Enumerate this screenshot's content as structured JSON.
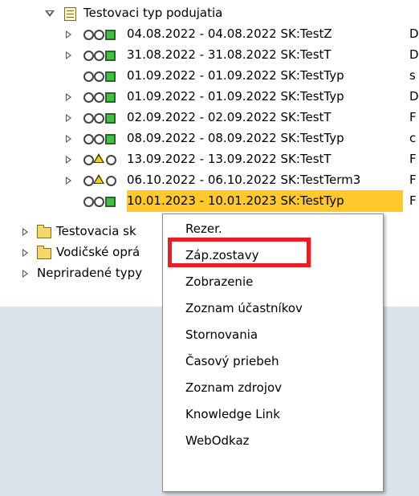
{
  "tree": {
    "root_label": "Testovaci typ podujatia",
    "events": [
      {
        "label": "04.08.2022 - 04.08.2022 SK:TestZ",
        "col2": "D",
        "status": "green",
        "expandable": true
      },
      {
        "label": "31.08.2022 - 31.08.2022 SK:TestT",
        "col2": "D",
        "status": "green",
        "expandable": true
      },
      {
        "label": "01.09.2022 - 01.09.2022 SK:TestTyp",
        "col2": "s",
        "status": "green",
        "expandable": false
      },
      {
        "label": "01.09.2022 - 01.09.2022 SK:TestTyp",
        "col2": "D",
        "status": "green",
        "expandable": true
      },
      {
        "label": "02.09.2022 - 02.09.2022 SK:TestT",
        "col2": "F",
        "status": "green",
        "expandable": true
      },
      {
        "label": "08.09.2022 - 08.09.2022 SK:TestTyp",
        "col2": "c",
        "status": "green",
        "expandable": true
      },
      {
        "label": "13.09.2022 - 13.09.2022 SK:TestT",
        "col2": "F",
        "status": "yellow",
        "expandable": true
      },
      {
        "label": "06.10.2022 - 06.10.2022 SK:TestTerm3",
        "col2": "F",
        "status": "yellow",
        "expandable": true
      },
      {
        "label": "10.01.2023 - 10.01.2023 SK:TestTyp",
        "col2": "F",
        "status": "green",
        "expandable": false,
        "selected": true
      }
    ],
    "folders": [
      {
        "label": "Testovacia sk"
      },
      {
        "label": "Vodičské oprá"
      }
    ],
    "unassigned": "Nepriradené typy"
  },
  "context_menu": {
    "items": [
      "Rezer.",
      "Záp.zostavy",
      "Zobrazenie",
      "Zoznam účastníkov",
      "Stornovania",
      "Časový priebeh",
      "Zoznam zdrojov",
      "Knowledge Link",
      "WebOdkaz"
    ],
    "highlighted": "Záp.zostavy"
  },
  "colors": {
    "selection": "#ffc92b",
    "highlight_box": "#ec1c24",
    "status_green": "#3fc23f",
    "status_yellow": "#f4d000"
  }
}
